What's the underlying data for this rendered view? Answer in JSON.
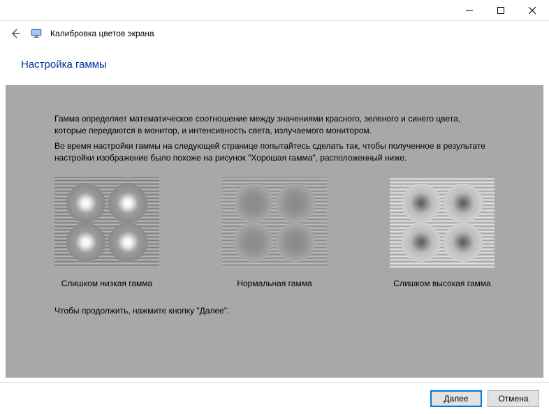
{
  "window": {
    "app_title": "Калибровка цветов экрана"
  },
  "page": {
    "heading": "Настройка гаммы",
    "paragraph1": "Гамма определяет математическое соотношение между значениями красного, зеленого и синего цвета, которые передаются в монитор, и интенсивность света, излучаемого монитором.",
    "paragraph2": "Во время настройки гаммы на следующей странице попытайтесь сделать так, чтобы полученное в результате настройки изображение было похоже на рисунок \"Хорошая гамма\", расположенный ниже.",
    "continue_hint": "Чтобы продолжить, нажмите кнопку \"Далее\"."
  },
  "samples": {
    "low": "Слишком низкая гамма",
    "normal": "Нормальная гамма",
    "high": "Слишком высокая гамма"
  },
  "footer": {
    "next": "Далее",
    "cancel": "Отмена"
  }
}
